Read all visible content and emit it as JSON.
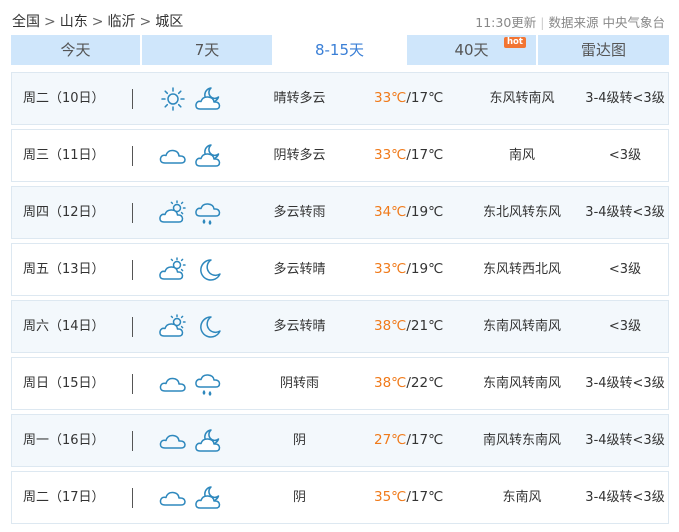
{
  "breadcrumb": [
    "全国",
    "山东",
    "临沂",
    "城区"
  ],
  "breadcrumb_separator": ">",
  "header": {
    "updated": "11:30更新",
    "source": "数据来源 中央气象台"
  },
  "tabs": [
    {
      "label": "今天",
      "active": false
    },
    {
      "label": "7天",
      "active": false
    },
    {
      "label": "8-15天",
      "active": true
    },
    {
      "label": "40天",
      "active": false,
      "badge": "hot"
    },
    {
      "label": "雷达图",
      "active": false
    }
  ],
  "colors": {
    "tab_bg": "#cfe6fb",
    "active_tab_text": "#3a7fd6",
    "high_temp": "#f07a1a",
    "icon_stroke": "#2e88bd",
    "hot_badge": "#f27533"
  },
  "forecast": [
    {
      "date": "周二（10日）",
      "icon_day": "sun-icon",
      "icon_night": "moon-cloud-icon",
      "condition": "晴转多云",
      "high": "33℃",
      "low": "/17℃",
      "wind": "东风转南风",
      "level": "3-4级转<3级"
    },
    {
      "date": "周三（11日）",
      "icon_day": "cloud-icon",
      "icon_night": "moon-cloud-icon",
      "condition": "阴转多云",
      "high": "33℃",
      "low": "/17℃",
      "wind": "南风",
      "level": "<3级"
    },
    {
      "date": "周四（12日）",
      "icon_day": "sun-cloud-icon",
      "icon_night": "rain-icon",
      "condition": "多云转雨",
      "high": "34℃",
      "low": "/19℃",
      "wind": "东北风转东风",
      "level": "3-4级转<3级"
    },
    {
      "date": "周五（13日）",
      "icon_day": "sun-cloud-icon",
      "icon_night": "moon-icon",
      "condition": "多云转晴",
      "high": "33℃",
      "low": "/19℃",
      "wind": "东风转西北风",
      "level": "<3级"
    },
    {
      "date": "周六（14日）",
      "icon_day": "sun-cloud-icon",
      "icon_night": "moon-icon",
      "condition": "多云转晴",
      "high": "38℃",
      "low": "/21℃",
      "wind": "东南风转南风",
      "level": "<3级"
    },
    {
      "date": "周日（15日）",
      "icon_day": "cloud-icon",
      "icon_night": "rain-icon",
      "condition": "阴转雨",
      "high": "38℃",
      "low": "/22℃",
      "wind": "东南风转南风",
      "level": "3-4级转<3级"
    },
    {
      "date": "周一（16日）",
      "icon_day": "cloud-icon",
      "icon_night": "moon-cloud-icon",
      "condition": "阴",
      "high": "27℃",
      "low": "/17℃",
      "wind": "南风转东南风",
      "level": "3-4级转<3级"
    },
    {
      "date": "周二（17日）",
      "icon_day": "cloud-icon",
      "icon_night": "moon-cloud-icon",
      "condition": "阴",
      "high": "35℃",
      "low": "/17℃",
      "wind": "东南风",
      "level": "3-4级转<3级"
    }
  ]
}
